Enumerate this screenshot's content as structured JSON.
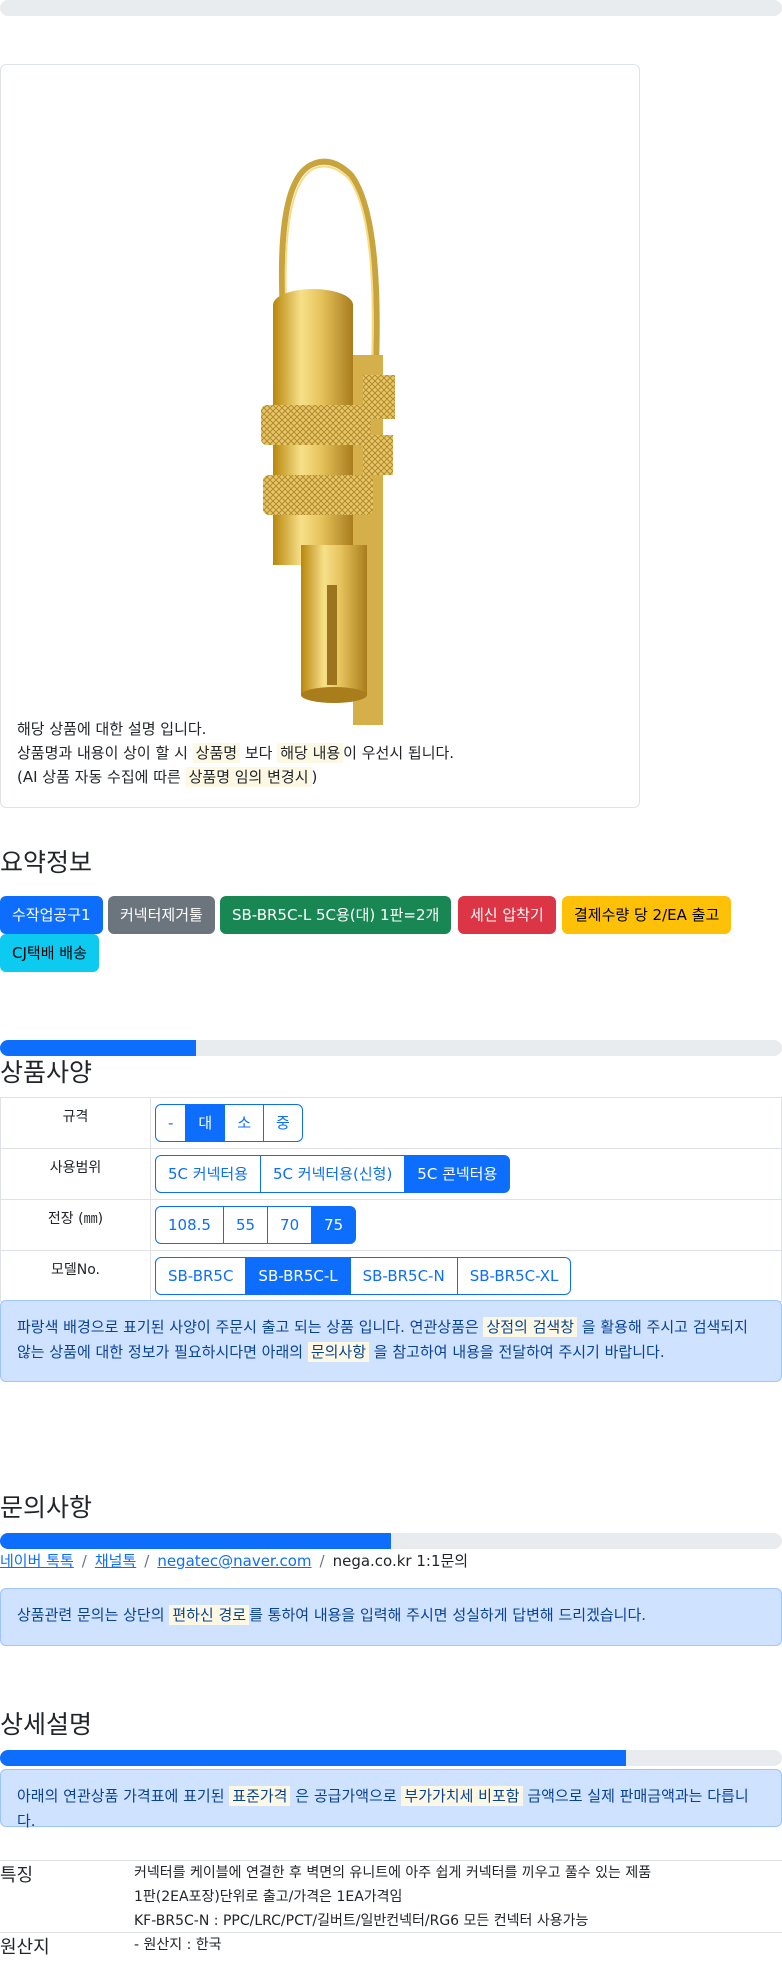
{
  "top_progress": {
    "value": 0
  },
  "card": {
    "lines": [
      {
        "parts": [
          {
            "text": "해당 상품에 대한 설명 입니다.",
            "mark": false
          }
        ]
      },
      {
        "parts": [
          {
            "text": "상품명과 내용이 상이 할 시 ",
            "mark": false
          },
          {
            "text": "상품명",
            "mark": true
          },
          {
            "text": " 보다 ",
            "mark": false
          },
          {
            "text": "해당 내용",
            "mark": true
          },
          {
            "text": "이 우선시 됩니다.",
            "mark": false
          }
        ]
      },
      {
        "parts": [
          {
            "text": "(AI 상품 자동 수집에 따른 ",
            "mark": false
          },
          {
            "text": "상품명 임의 변경시",
            "mark": true
          },
          {
            "text": ")",
            "mark": false
          }
        ]
      }
    ]
  },
  "summary": {
    "title": "요약정보",
    "badges": [
      {
        "label": "수작업공구1",
        "color": "#0d6efd",
        "text_color": "#ffffff"
      },
      {
        "label": "커넥터제거툴",
        "color": "#6c757d",
        "text_color": "#ffffff"
      },
      {
        "label": "SB-BR5C-L 5C용(대) 1판=2개",
        "color": "#198754",
        "text_color": "#ffffff"
      },
      {
        "label": "세신 압착기",
        "color": "#dc3545",
        "text_color": "#ffffff"
      },
      {
        "label": "결제수량 당 2/EA 출고",
        "color": "#ffc107",
        "text_color": "#000000"
      },
      {
        "label": "CJ택배 배송",
        "color": "#0dcaf0",
        "text_color": "#000000"
      }
    ]
  },
  "specs": {
    "title": "상품사양",
    "progress": 0.25,
    "rows": [
      {
        "label": "규격",
        "options": [
          "-",
          "대",
          "소",
          "중"
        ],
        "active": 1
      },
      {
        "label": "사용범위",
        "options": [
          "5C 커넥터용",
          "5C 커넥터용(신형)",
          "5C 콘넥터용"
        ],
        "active": 2
      },
      {
        "label": "전장 (㎜)",
        "options": [
          "108.5",
          "55",
          "70",
          "75"
        ],
        "active": 3
      },
      {
        "label": "모델No.",
        "options": [
          "SB-BR5C",
          "SB-BR5C-L",
          "SB-BR5C-N",
          "SB-BR5C-XL"
        ],
        "active": 1
      }
    ],
    "notice_parts": [
      {
        "text": "파랑색 배경으로 표기된 사양이 주문시 출고 되는 상품 입니다. 연관상품은 ",
        "mark": false
      },
      {
        "text": "상점의 검색창",
        "mark": true
      },
      {
        "text": " 을 활용해 주시고 검색되지 않는 상품에 대한 정보가 필요하시다면 아래의 ",
        "mark": false
      },
      {
        "text": "문의사항",
        "mark": true
      },
      {
        "text": " 을 참고하여 내용을 전달하여 주시기 바랍니다.",
        "mark": false
      }
    ]
  },
  "inquiry": {
    "title": "문의사항",
    "progress": 0.5,
    "links": [
      {
        "label": "네이버 톡톡",
        "link": true
      },
      {
        "label": "채널톡",
        "link": true
      },
      {
        "label": "negatec@naver.com",
        "link": true
      },
      {
        "label": "nega.co.kr 1:1문의",
        "link": false
      }
    ],
    "notice_parts": [
      {
        "text": "상품관련 문의는 상단의 ",
        "mark": false
      },
      {
        "text": "편하신 경로",
        "mark": true
      },
      {
        "text": "를 통하여 내용을 입력해 주시면 성실하게 답변해 드리겠습니다.",
        "mark": false
      }
    ]
  },
  "detail": {
    "title": "상세설명",
    "progress": 0.8,
    "notice_parts": [
      {
        "text": "아래의 연관상품 가격표에 표기된 ",
        "mark": false
      },
      {
        "text": "표준가격",
        "mark": true
      },
      {
        "text": " 은 공급가액으로 ",
        "mark": false
      },
      {
        "text": "부가가치세 비포함",
        "mark": true
      },
      {
        "text": " 금액으로 실제 판매금액과는 다릅니다.",
        "mark": false
      }
    ],
    "features": [
      {
        "key": "특징",
        "values": [
          "커넥터를 케이블에 연결한 후 벽면의 유니트에 아주 쉽게 커넥터를 끼우고 풀수 있는 제품",
          "1판(2EA포장)단위로 출고/가격은 1EA가격임",
          "KF-BR5C-N : PPC/LRC/PCT/길버트/일반컨넥터/RG6 모든 컨넥터 사용가능"
        ]
      },
      {
        "key": "원산지",
        "values": [
          "- 원산지 : 한국"
        ]
      }
    ]
  }
}
